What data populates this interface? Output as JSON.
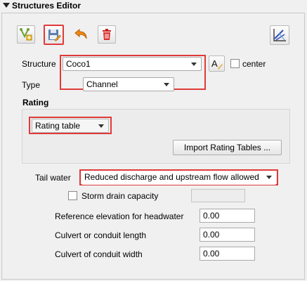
{
  "panel": {
    "title": "Structures Editor"
  },
  "toolbar": {
    "add_icon": "add-structure-icon",
    "save_icon": "save-edit-icon",
    "undo_icon": "undo-icon",
    "delete_icon": "delete-icon",
    "plot_icon": "profile-plot-icon"
  },
  "structure": {
    "label": "Structure",
    "value": "Coco1",
    "center_label": "center"
  },
  "type": {
    "label": "Type",
    "value": "Channel"
  },
  "rating": {
    "label": "Rating",
    "value": "Rating table",
    "import_button": "Import Rating Tables ..."
  },
  "tailwater": {
    "label": "Tail water",
    "value": "Reduced discharge and upstream flow allowed"
  },
  "storm_drain": {
    "label": "Storm drain capacity"
  },
  "fields": [
    {
      "label": "Reference elevation for headwater",
      "value": "0.00"
    },
    {
      "label": "Culvert or conduit length",
      "value": "0.00"
    },
    {
      "label": "Culvert of conduit width",
      "value": "0.00"
    }
  ],
  "colors": {
    "highlight": "#e03a3a"
  }
}
